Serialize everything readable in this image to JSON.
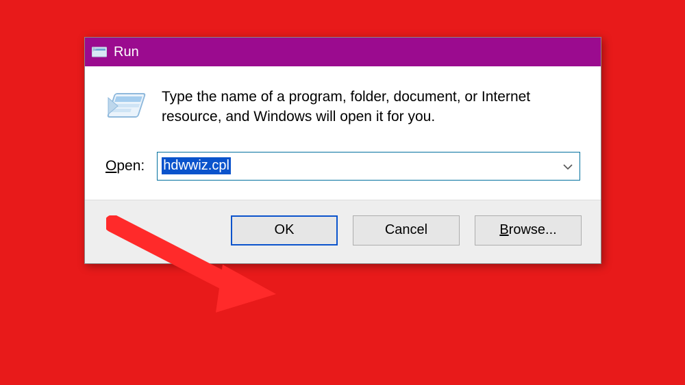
{
  "titlebar": {
    "title": "Run"
  },
  "body": {
    "instruction": "Type the name of a program, folder, document, or Internet resource, and Windows will open it for you.",
    "open_label_char": "O",
    "open_label_rest": "pen:",
    "combo_value": "hdwwiz.cpl"
  },
  "buttons": {
    "ok": "OK",
    "cancel": "Cancel",
    "browse_char": "B",
    "browse_rest": "rowse..."
  }
}
